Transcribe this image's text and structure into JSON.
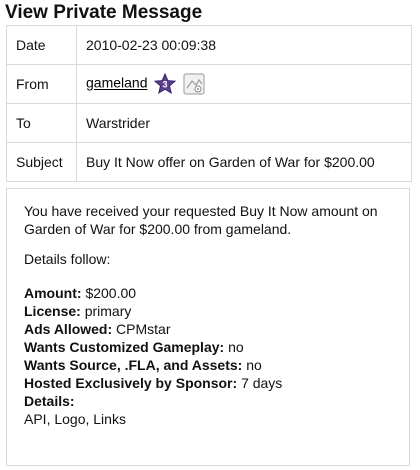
{
  "page": {
    "title": "View Private Message"
  },
  "meta": {
    "date_label": "Date",
    "date_value": "2010-02-23 00:09:38",
    "from_label": "From",
    "from_user": "gameland",
    "from_level_badge": "3",
    "to_label": "To",
    "to_value": "Warstrider",
    "subject_label": "Subject",
    "subject_value": "Buy It Now offer on Garden of War for $200.00"
  },
  "icons": {
    "level_badge": "purple-star-badge-icon",
    "profile_badge": "grey-profile-badge-icon",
    "level_badge_color": "#5b3f8e"
  },
  "message": {
    "intro": "You have received your requested Buy It Now amount on Garden of War for $200.00 from gameland.",
    "details_follow": "Details follow:",
    "fields": [
      {
        "label": "Amount:",
        "value": "$200.00"
      },
      {
        "label": "License:",
        "value": "primary"
      },
      {
        "label": "Ads Allowed:",
        "value": "CPMstar"
      },
      {
        "label": "Wants Customized Gameplay:",
        "value": "no"
      },
      {
        "label": "Wants Source, .FLA, and Assets:",
        "value": "no"
      },
      {
        "label": "Hosted Exclusively by Sponsor:",
        "value": "7 days"
      },
      {
        "label": "Details:",
        "value": ""
      }
    ],
    "details_text": "API, Logo, Links"
  }
}
